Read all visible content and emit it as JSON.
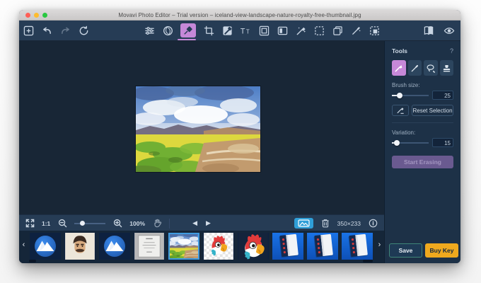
{
  "titlebar": {
    "title": "Movavi Photo Editor – Trial version – iceland-view-landscape-nature-royalty-free-thumbnail.jpg"
  },
  "toolbar": {
    "left_icons": [
      "add-file-icon",
      "undo-icon",
      "redo-icon",
      "reset-icon"
    ],
    "center_icons": [
      "adjust-icon",
      "effects-icon",
      "object-removal-icon",
      "crop-icon",
      "background-removal-icon",
      "text-icon",
      "frames-icon",
      "split-view-icon",
      "retouch-icon",
      "selection-icon",
      "copy-icon",
      "magic-wand-icon",
      "paste-selection-icon"
    ],
    "right_icons": [
      "before-after-icon",
      "preview-eye-icon"
    ],
    "selected_icon": "object-removal-icon"
  },
  "tools_panel": {
    "title": "Tools",
    "help_label": "?",
    "tool_icons": [
      "brush-icon",
      "magic-wand-icon",
      "lasso-icon",
      "stamp-icon"
    ],
    "selected_tool": "brush-icon",
    "brush_size": {
      "label": "Brush size:",
      "value": "25"
    },
    "eraser_button_icon": "eraser-icon",
    "reset_selection_label": "Reset Selection",
    "variation": {
      "label": "Variation:",
      "value": "15"
    },
    "start_erasing_label": "Start Erasing"
  },
  "status_bar": {
    "fit_icon": "fit-screen-icon",
    "actual_size_label": "1:1",
    "zoom_out_icon": "zoom-out-icon",
    "zoom_in_icon": "zoom-in-icon",
    "zoom_value": "100%",
    "hand_icon": "hand-icon",
    "prev_icon": "◀",
    "next_icon": "▶",
    "filmstrip_toggle_icon": "filmstrip-toggle-icon",
    "trash_icon": "trash-icon",
    "dimensions": "350×233",
    "info_icon": "info-icon"
  },
  "filmstrip": {
    "prev_label": "‹",
    "next_label": "›",
    "items": [
      {
        "icon": "mountain-logo-thumb"
      },
      {
        "icon": "portrait-thumb"
      },
      {
        "icon": "mountain-logo-thumb"
      },
      {
        "icon": "certificate-thumb"
      },
      {
        "icon": "landscape-thumb",
        "selected": true
      },
      {
        "icon": "parrot-light-thumb"
      },
      {
        "icon": "parrot-dark-thumb"
      },
      {
        "icon": "blue-book-thumb"
      },
      {
        "icon": "blue-book-thumb"
      },
      {
        "icon": "blue-book-thumb"
      }
    ]
  },
  "footer": {
    "save_label": "Save",
    "buy_key_label": "Buy Key"
  },
  "colors": {
    "accent_pink": "#c688d8",
    "accent_blue": "#2f9fd8",
    "buy_key_orange": "#efa91e",
    "toolbar_bg": "#263c55",
    "canvas_bg": "#182636",
    "panel_bg": "#1d3147",
    "filmstrip_bg": "#152639",
    "save_border_green": "#3f8578"
  }
}
